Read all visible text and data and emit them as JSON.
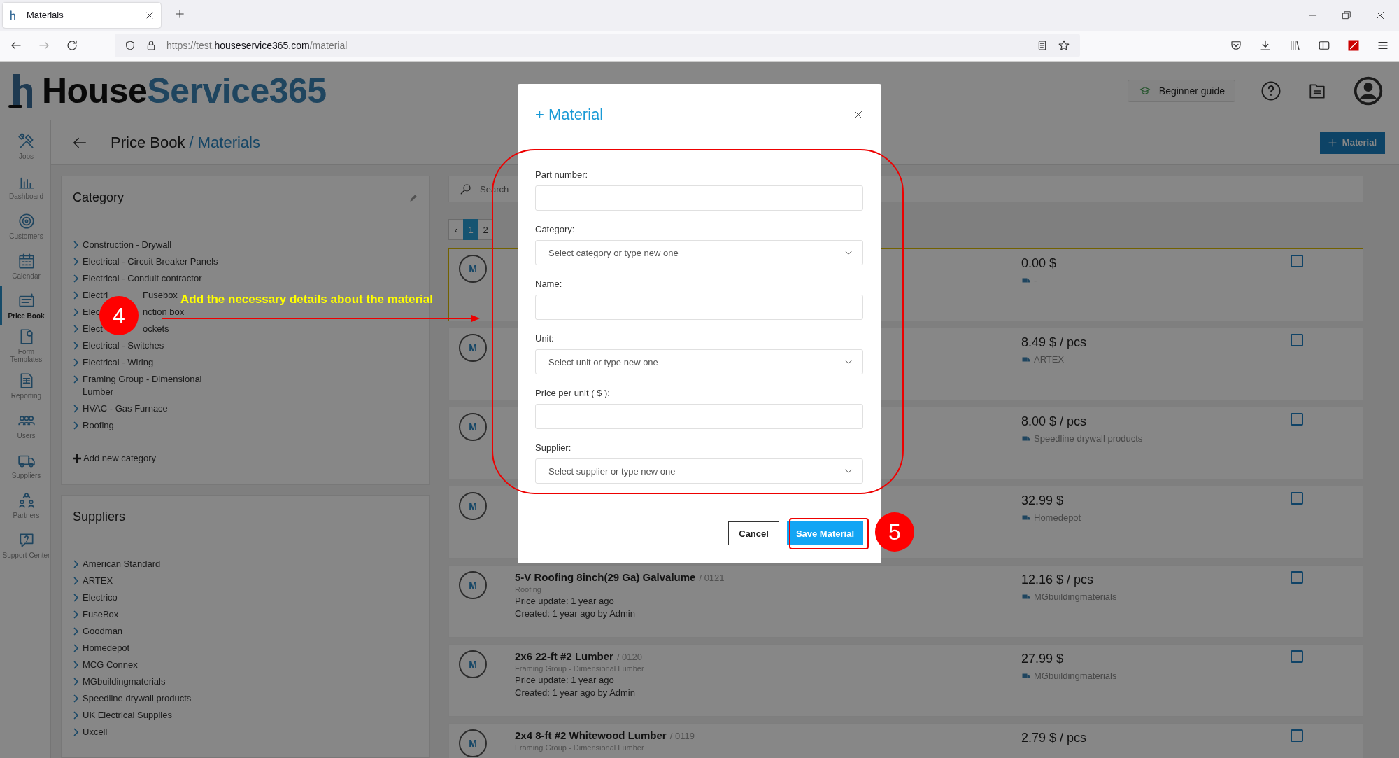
{
  "browser": {
    "tab_title": "Materials",
    "url": {
      "scheme": "https://test.",
      "domain": "houseservice365.com",
      "path": "/material"
    }
  },
  "header": {
    "logo": {
      "first": "House",
      "second": "Service365"
    },
    "guide_button": "Beginner guide"
  },
  "nav": [
    {
      "label": "Jobs",
      "selected": false
    },
    {
      "label": "Dashboard",
      "selected": false
    },
    {
      "label": "Customers",
      "selected": false
    },
    {
      "label": "Calendar",
      "selected": false
    },
    {
      "label": "Price Book",
      "selected": true
    },
    {
      "label": "Form Templates",
      "selected": false
    },
    {
      "label": "Reporting",
      "selected": false
    },
    {
      "label": "Users",
      "selected": false
    },
    {
      "label": "Suppliers",
      "selected": false
    },
    {
      "label": "Partners",
      "selected": false
    },
    {
      "label": "Support Center",
      "selected": false
    }
  ],
  "breadcrumb": {
    "parent": "Price Book",
    "current": "/ Materials"
  },
  "add_button": "Material",
  "category_panel": {
    "title": "Category",
    "items": [
      {
        "kind": "whole",
        "label": "Construction - Drywall"
      },
      {
        "kind": "whole",
        "label": "Electrical - Circuit Breaker Panels"
      },
      {
        "kind": "whole",
        "label": "Electrical - Conduit contractor"
      },
      {
        "kind": "split",
        "parts": [
          "Electri",
          "Fusebox"
        ]
      },
      {
        "kind": "split",
        "parts": [
          "Elec",
          "nction box"
        ]
      },
      {
        "kind": "split",
        "parts": [
          "Elect",
          "ockets"
        ]
      },
      {
        "kind": "whole",
        "label": "Electrical - Switches"
      },
      {
        "kind": "whole",
        "label": "Electrical - Wiring"
      },
      {
        "kind": "whole",
        "label": "Framing Group - Dimensional Lumber"
      },
      {
        "kind": "whole",
        "label": "HVAC - Gas Furnace"
      },
      {
        "kind": "whole",
        "label": "Roofing"
      }
    ],
    "add_label": "Add new category"
  },
  "suppliers_panel": {
    "title": "Suppliers",
    "items": [
      "American Standard",
      "ARTEX",
      "Electrico",
      "FuseBox",
      "Goodman",
      "Homedepot",
      "MCG Connex",
      "MGbuildingmaterials",
      "Speedline drywall products",
      "UK Electrical Supplies",
      "Uxcell"
    ]
  },
  "search": {
    "placeholder": "Search"
  },
  "pagination": [
    {
      "label": "‹",
      "selected": false
    },
    {
      "label": "1",
      "selected": true
    },
    {
      "label": "2",
      "selected": false
    }
  ],
  "materials": [
    {
      "avatar": "M",
      "price": "0.00 $",
      "supplier": "-",
      "highlighted": true,
      "checked": false
    },
    {
      "avatar": "M",
      "price": "8.49 $ / pcs",
      "supplier": "ARTEX",
      "highlighted": false,
      "checked": false
    },
    {
      "avatar": "M",
      "price": "8.00 $ / pcs",
      "supplier": "Speedline drywall products",
      "highlighted": false,
      "checked": false
    },
    {
      "avatar": "M",
      "price": "32.99 $",
      "supplier": "Homedepot",
      "highlighted": false,
      "checked": false
    },
    {
      "avatar": "M",
      "name": "5-V Roofing 8inch(29 Ga) Galvalume",
      "code": "/ 0121",
      "category": "Roofing",
      "price_update": "Price update: 1 year ago",
      "created": "Created: 1 year ago by Admin",
      "price": "12.16 $ / pcs",
      "supplier": "MGbuildingmaterials",
      "highlighted": false,
      "checked": false
    },
    {
      "avatar": "M",
      "name": "2x6 22-ft #2 Lumber",
      "code": "/ 0120",
      "category": "Framing Group - Dimensional Lumber",
      "price_update": "Price update: 1 year ago",
      "created": "Created: 1 year ago by Admin",
      "price": "27.99 $",
      "supplier": "MGbuildingmaterials",
      "highlighted": false,
      "checked": false
    },
    {
      "avatar": "M",
      "name": "2x4 8-ft #2 Whitewood Lumber",
      "code": "/ 0119",
      "category": "Framing Group - Dimensional Lumber",
      "price": "2.79 $ / pcs",
      "highlighted": false,
      "checked": false
    }
  ],
  "modal": {
    "title": "+ Material",
    "fields": [
      {
        "kind": "input",
        "label": "Part number:"
      },
      {
        "kind": "select",
        "label": "Category:",
        "placeholder": "Select category or type new one"
      },
      {
        "kind": "input",
        "label": "Name:"
      },
      {
        "kind": "select",
        "label": "Unit:",
        "placeholder": "Select unit or type new one"
      },
      {
        "kind": "input",
        "label": "Price per unit ( $ ):"
      },
      {
        "kind": "select",
        "label": "Supplier:",
        "placeholder": "Select supplier or type new one"
      }
    ],
    "buttons": [
      {
        "kind": "secondary",
        "label": "Cancel"
      },
      {
        "kind": "primary",
        "label": "Save Material"
      }
    ]
  },
  "annotations": {
    "step_badges": [
      "4",
      "5"
    ],
    "callout": "Add the necessary details about the material"
  }
}
